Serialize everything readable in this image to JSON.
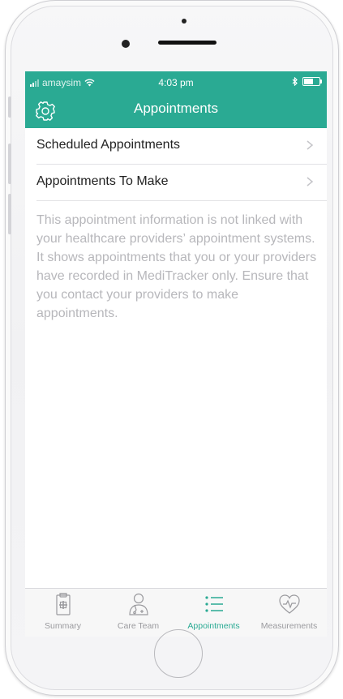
{
  "status_bar": {
    "carrier": "amaysim",
    "time": "4:03 pm",
    "wifi_icon": "wifi-icon",
    "bluetooth_icon": "bluetooth-icon",
    "battery_icon": "battery-icon"
  },
  "nav": {
    "title": "Appointments",
    "settings_icon": "gear-icon"
  },
  "list": {
    "items": [
      {
        "label": "Scheduled Appointments"
      },
      {
        "label": "Appointments To Make"
      }
    ]
  },
  "info_text": "This appointment information is not linked with your healthcare providers’ appointment systems. It shows appointments that you or your providers have recorded in MediTracker only. Ensure that you contact your providers to make appointments.",
  "tabs": [
    {
      "label": "Summary",
      "icon": "clipboard-icon",
      "active": false
    },
    {
      "label": "Care Team",
      "icon": "doctor-icon",
      "active": false
    },
    {
      "label": "Appointments",
      "icon": "list-icon",
      "active": true
    },
    {
      "label": "Measurements",
      "icon": "heart-pulse-icon",
      "active": false
    }
  ],
  "colors": {
    "accent": "#2aaa93",
    "inactive": "#9a9a9e",
    "info_text": "#b7b7bb"
  }
}
